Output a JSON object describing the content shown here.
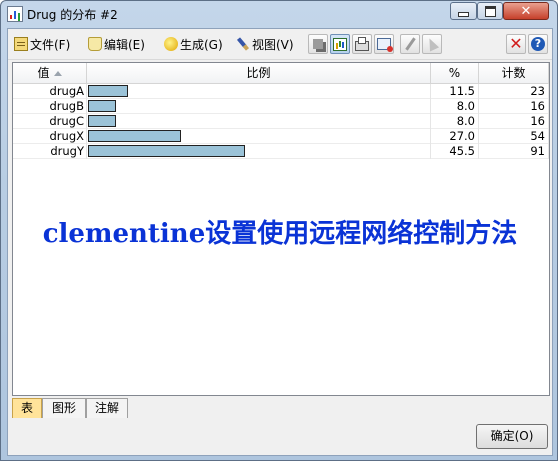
{
  "window": {
    "title": "Drug 的分布 #2"
  },
  "menu": [
    {
      "label": "文件(F)",
      "icon": "file-icon"
    },
    {
      "label": "编辑(E)",
      "icon": "edit-icon"
    },
    {
      "label": "生成(G)",
      "icon": "generate-icon"
    },
    {
      "label": "视图(V)",
      "icon": "view-icon"
    }
  ],
  "table": {
    "columns": [
      "值",
      "比例",
      "%",
      "计数"
    ],
    "rows": [
      {
        "value": "drugA",
        "pct": "11.5",
        "count": "23",
        "share": 11.5
      },
      {
        "value": "drugB",
        "pct": "8.0",
        "count": "16",
        "share": 8.0
      },
      {
        "value": "drugC",
        "pct": "8.0",
        "count": "16",
        "share": 8.0
      },
      {
        "value": "drugX",
        "pct": "27.0",
        "count": "54",
        "share": 27.0
      },
      {
        "value": "drugY",
        "pct": "45.5",
        "count": "91",
        "share": 45.5
      }
    ]
  },
  "tabs": [
    "表",
    "图形",
    "注解"
  ],
  "active_tab": "表",
  "ok_button": "确定(O)",
  "watermark": "clementine设置使用远程网络控制方法",
  "colors": {
    "bar_fill": "#9bc3d8",
    "watermark": "#0a33d6",
    "active_tab": "#ffe39a"
  }
}
